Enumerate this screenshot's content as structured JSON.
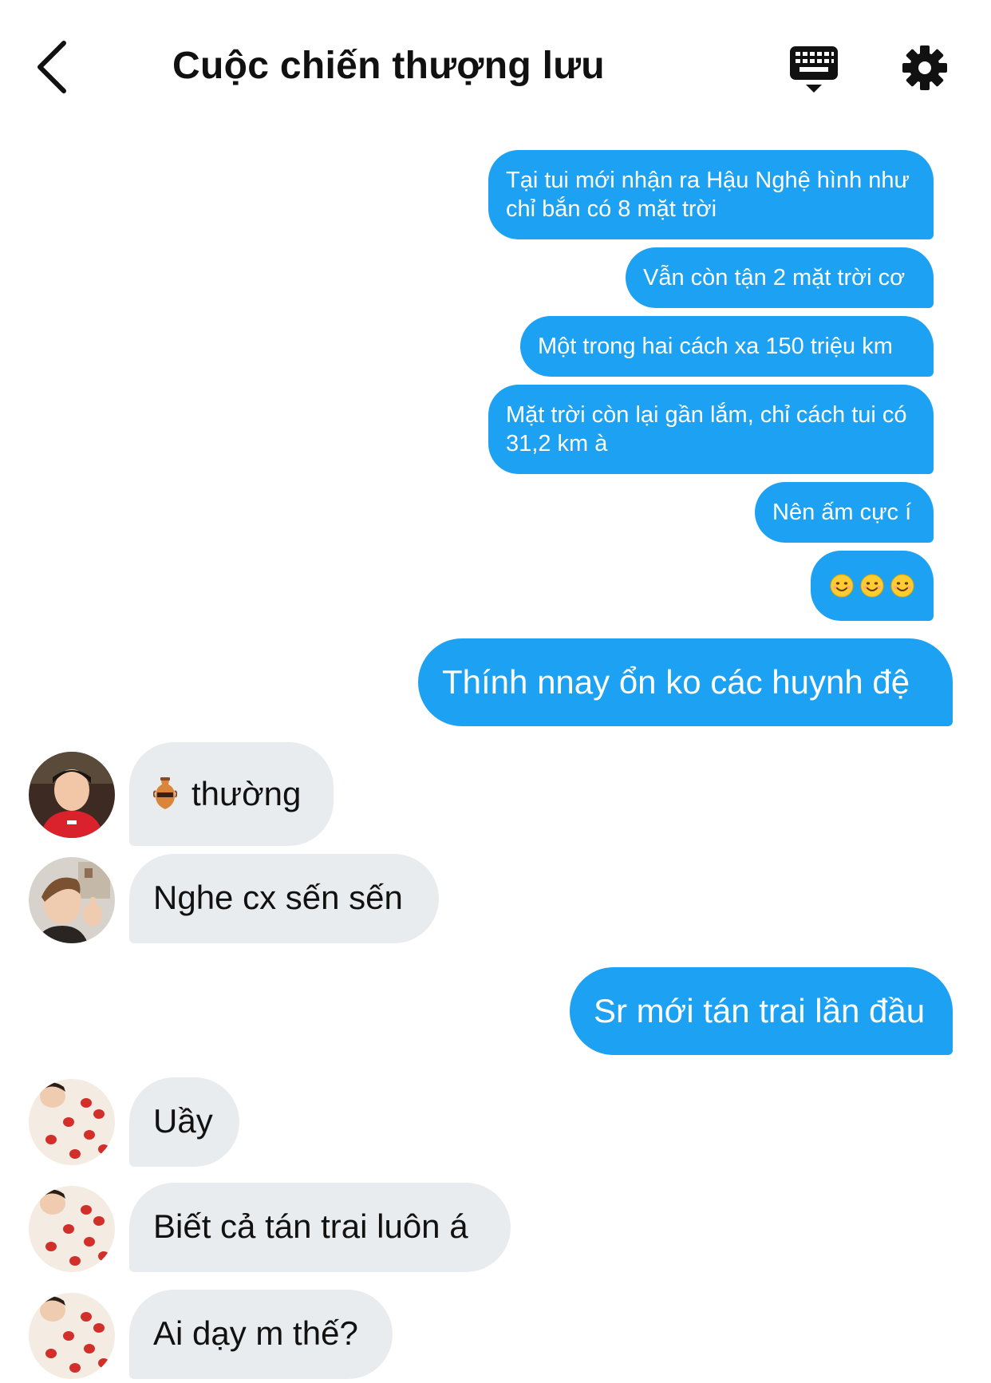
{
  "header": {
    "title": "Cuộc chiến thượng lưu",
    "back_icon": "chevron-left-icon",
    "keyboard_icon": "keyboard-icon",
    "settings_icon": "gear-icon"
  },
  "colors": {
    "outgoing_bubble": "#1da1f2",
    "incoming_bubble": "#e9ecef",
    "text_dark": "#111111"
  },
  "messages": [
    {
      "direction": "out",
      "text": "Tại tui mới nhận ra Hậu Nghệ hình như chỉ bắn có 8 mặt trời"
    },
    {
      "direction": "out",
      "text": "Vẫn còn tận 2 mặt trời cơ"
    },
    {
      "direction": "out",
      "text": "Một trong hai cách xa 150 triệu km"
    },
    {
      "direction": "out",
      "text": "Mặt trời còn lại gần lắm, chỉ cách tui có 31,2 km à"
    },
    {
      "direction": "out",
      "text": "Nên ấm cực í"
    },
    {
      "direction": "out",
      "text": "😊😊😊",
      "icon": "smiling-face-emoji-icon"
    },
    {
      "direction": "out",
      "text": "Thính nnay ổn ko các huynh đệ"
    },
    {
      "direction": "in",
      "text": "thường",
      "icon": "amphora-emoji-icon",
      "sender_avatar": "avatar-red-hoodie"
    },
    {
      "direction": "in",
      "text": "Nghe cx sến sến",
      "sender_avatar": "avatar-thumbs-up"
    },
    {
      "direction": "out",
      "text": "Sr mới tán trai lần đầu"
    },
    {
      "direction": "in",
      "text": "Uầy",
      "sender_avatar": "avatar-strawberries"
    },
    {
      "direction": "in",
      "text": "Biết cả tán trai luôn á",
      "sender_avatar": "avatar-strawberries"
    },
    {
      "direction": "in",
      "text": "Ai dạy m thế?",
      "sender_avatar": "avatar-strawberries"
    }
  ]
}
